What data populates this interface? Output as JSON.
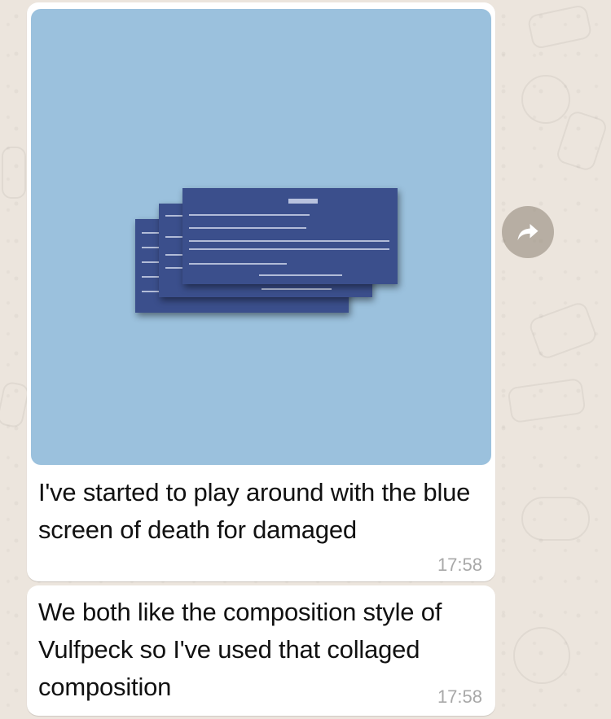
{
  "messages": [
    {
      "type": "image",
      "text": "I've started to play around with the blue screen of death for damaged",
      "time": "17:58"
    },
    {
      "type": "text",
      "text": "We both like the composition style of Vulfpeck so I've used that collaged composition",
      "time": "17:58"
    }
  ],
  "colors": {
    "wallpaper": "#ece5dd",
    "bubble": "#ffffff",
    "photo_background": "#9bc1dd",
    "bsod_screen": "#3b4f8c",
    "timestamp": "#a8a8a8",
    "forward_button": "#918778"
  },
  "icons": {
    "forward": "forward-arrow-icon"
  }
}
